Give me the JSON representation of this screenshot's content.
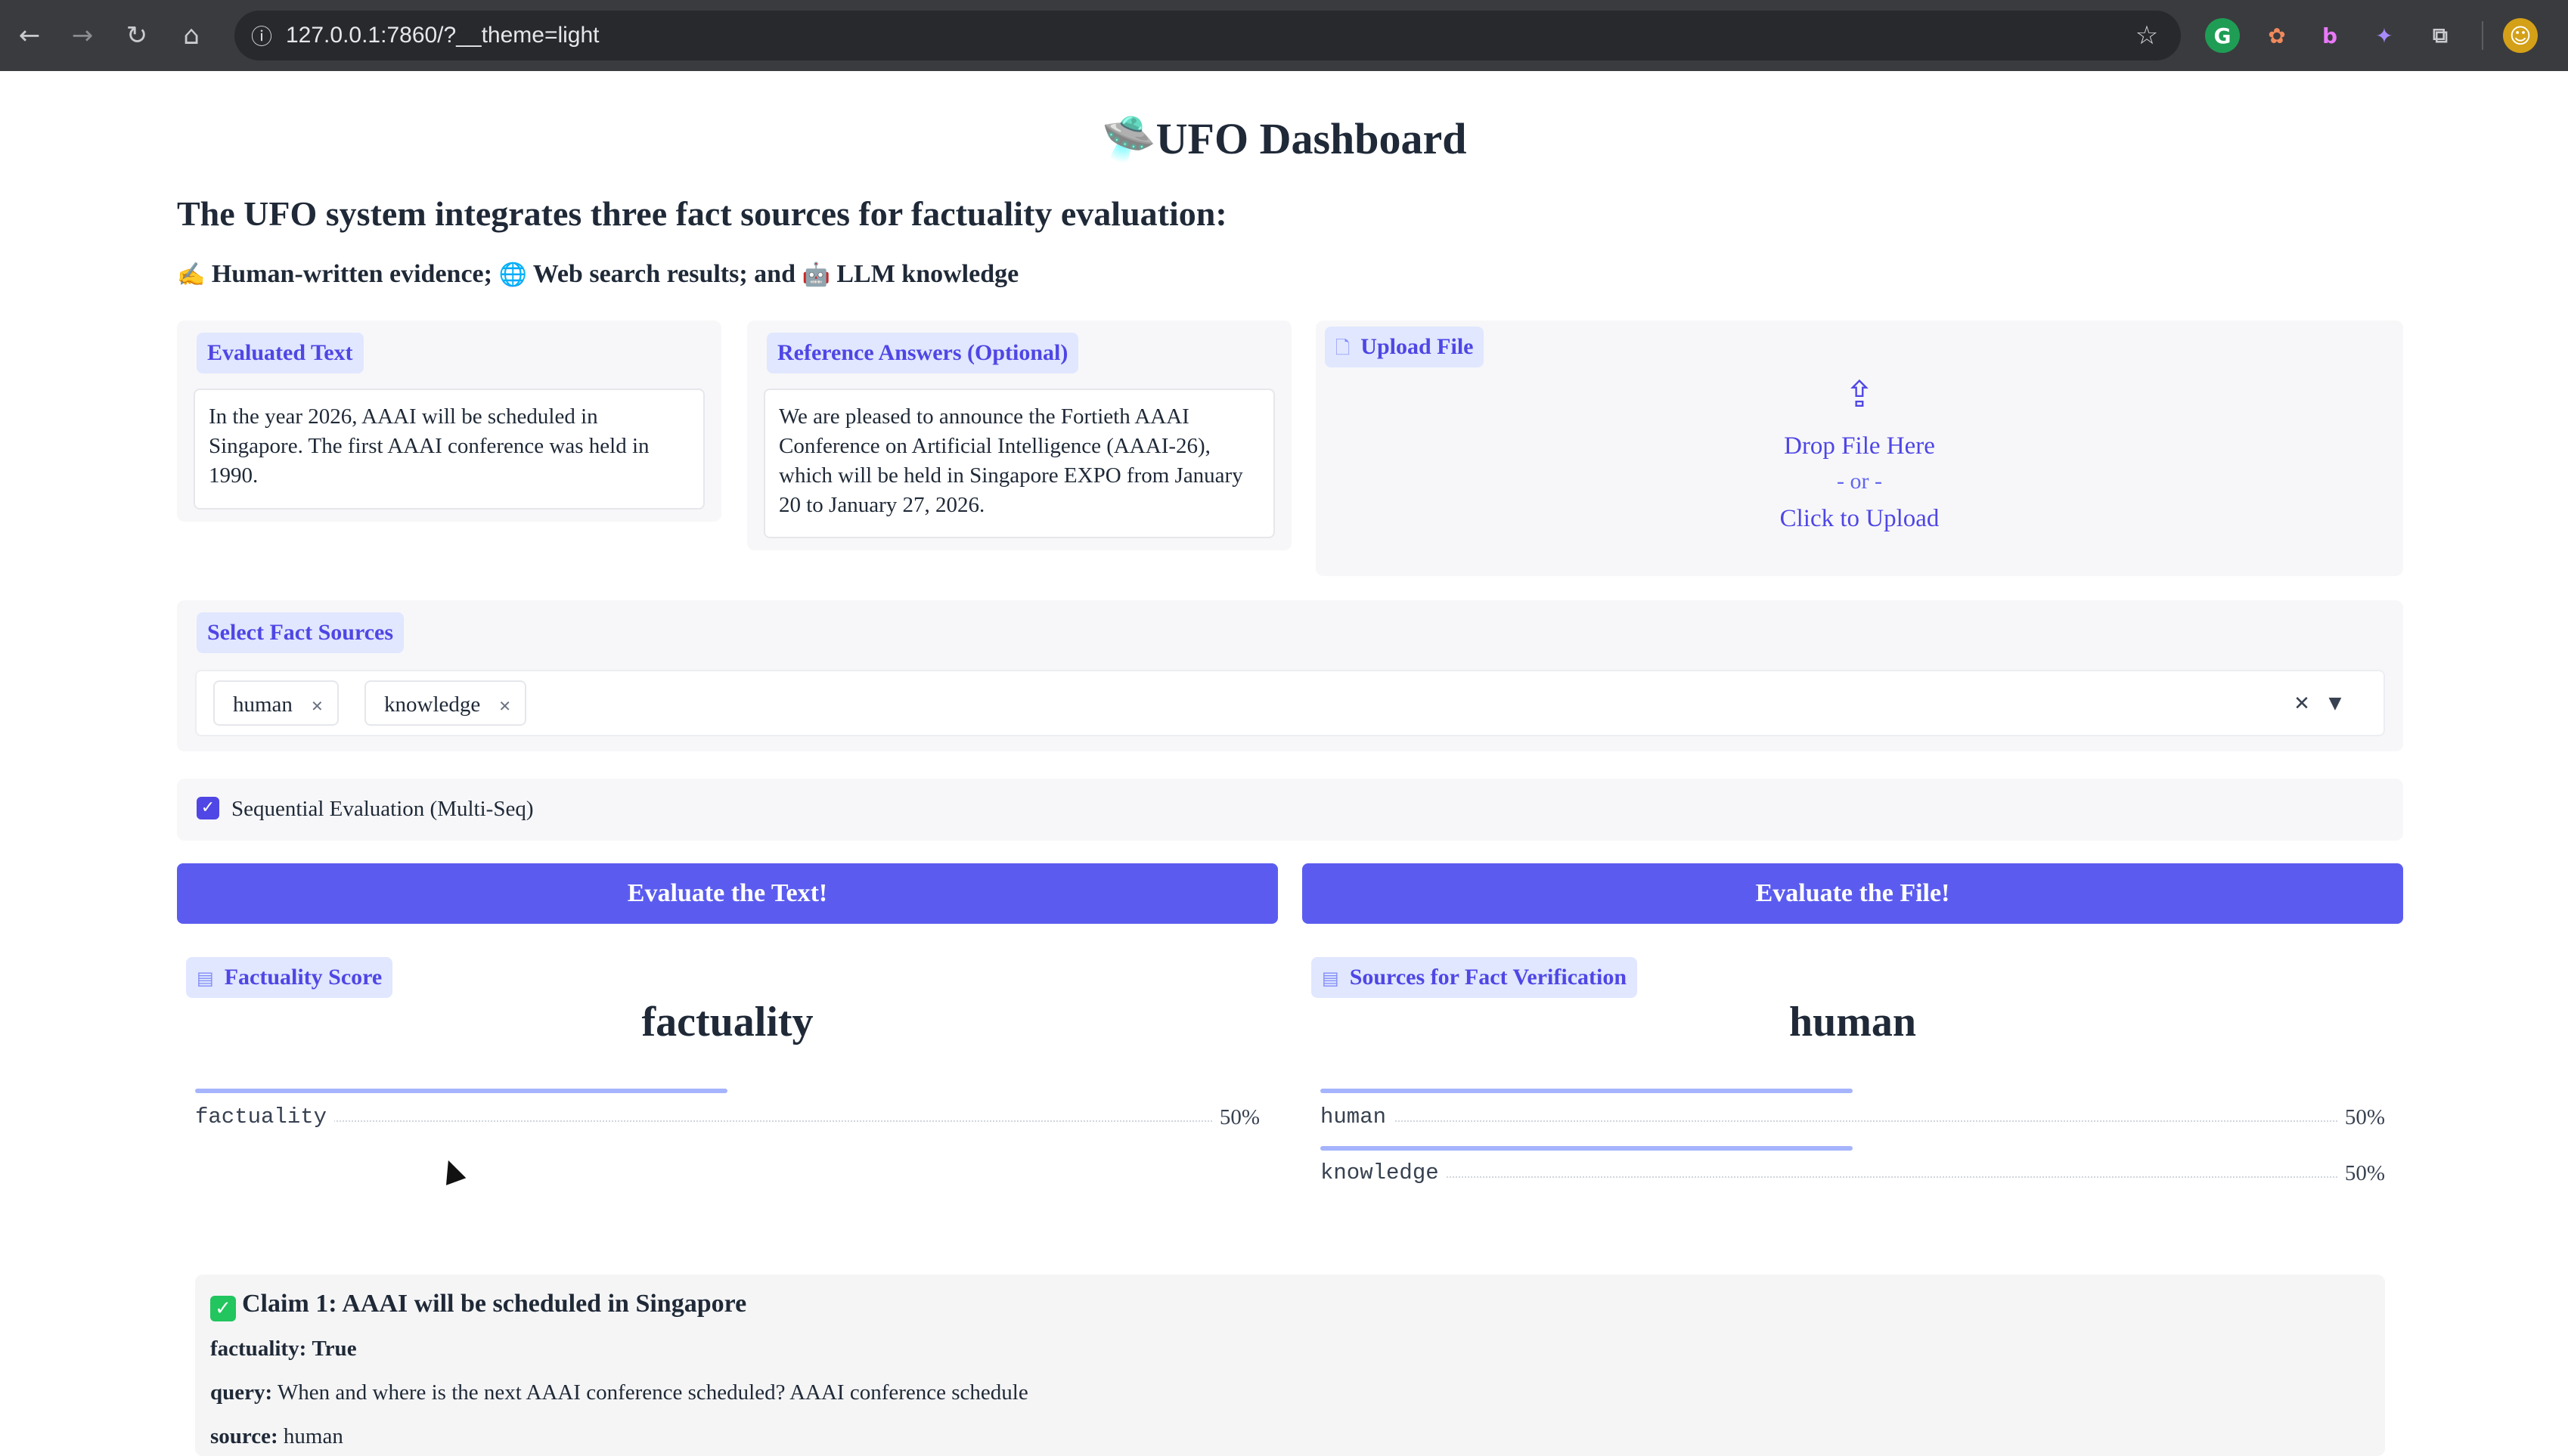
{
  "browser": {
    "url": "127.0.0.1:7860/?__theme=light",
    "icons": [
      "back-icon",
      "forward-icon",
      "reload-icon",
      "home-icon",
      "info-icon",
      "star-icon",
      "grammarly-icon",
      "extension-icon",
      "bing-icon",
      "extension-icon",
      "puzzle-icon",
      "profile-icon"
    ]
  },
  "header": {
    "title": "🛸UFO Dashboard",
    "subtitle": "The UFO system integrates three fact sources for factuality evaluation:",
    "sources_line": {
      "human_icon": "✍️",
      "human": "Human-written evidence;",
      "web_icon": "🌐",
      "web": "Web search results; and",
      "llm_icon": "🤖",
      "llm": "LLM knowledge"
    }
  },
  "evaluated_text": {
    "label": "Evaluated Text",
    "value": "In the year 2026, AAAI will be scheduled in Singapore. The first AAAI conference was held in 1990."
  },
  "reference": {
    "label": "Reference Answers (Optional)",
    "value": "We are pleased to announce the Fortieth AAAI Conference on Artificial Intelligence (AAAI-26), which will be held in Singapore EXPO from January 20 to January 27, 2026."
  },
  "upload": {
    "label": "Upload File",
    "drop": "Drop File Here",
    "or": "- or -",
    "click": "Click to Upload"
  },
  "fact_sources": {
    "label": "Select Fact Sources",
    "selected": [
      "human",
      "knowledge"
    ]
  },
  "sequential": {
    "label": "Sequential Evaluation (Multi-Seq)",
    "checked": true
  },
  "buttons": {
    "evaluate_text": "Evaluate the Text!",
    "evaluate_file": "Evaluate the File!"
  },
  "factuality_score": {
    "label": "Factuality Score",
    "top": "factuality",
    "rows": [
      {
        "name": "factuality",
        "pct": "50%",
        "value": 0.5
      }
    ]
  },
  "sources_verification": {
    "label": "Sources for Fact Verification",
    "top": "human",
    "rows": [
      {
        "name": "human",
        "pct": "50%",
        "value": 0.5
      },
      {
        "name": "knowledge",
        "pct": "50%",
        "value": 0.5
      }
    ]
  },
  "claim": {
    "title": "Claim 1: AAAI will be scheduled in Singapore",
    "factuality_label": "factuality:",
    "factuality_value": "True",
    "query_label": "query:",
    "query_value": "When and where is the next AAAI conference scheduled? AAAI conference schedule",
    "source_label": "source:",
    "source_value": "human"
  }
}
